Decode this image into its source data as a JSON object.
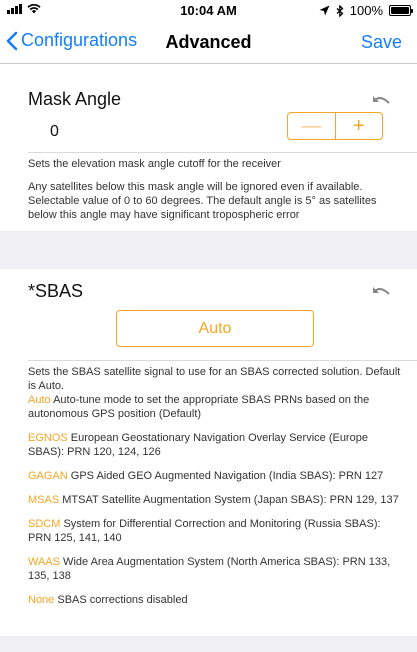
{
  "status_bar": {
    "time": "10:04 AM",
    "battery": "100%"
  },
  "nav": {
    "back_label": "Configurations",
    "title": "Advanced",
    "save_label": "Save"
  },
  "mask_angle": {
    "title": "Mask Angle",
    "value": "0",
    "minus_label": "—",
    "plus_label": "+",
    "summary": "Sets the elevation mask angle cutoff for the receiver",
    "details": "Any satellites below this mask angle will be ignored even if available. Selectable value of 0 to 60 degrees. The default angle is 5° as satellites below this angle may have significant tropospheric error"
  },
  "sbas": {
    "title": "*SBAS",
    "selected": "Auto",
    "summary": "Sets the SBAS satellite signal to use for an SBAS corrected solution. Default is Auto.",
    "options": [
      {
        "key": "Auto",
        "text": " Auto-tune mode to set the appropriate SBAS PRNs based on the autonomous GPS position (Default)"
      },
      {
        "key": "EGNOS",
        "text": " European Geostationary Navigation Overlay Service (Europe SBAS): PRN 120, 124, 126"
      },
      {
        "key": "GAGAN",
        "text": " GPS Aided GEO Augmented Navigation (India SBAS): PRN 127"
      },
      {
        "key": "MSAS",
        "text": " MTSAT Satellite Augmentation System (Japan SBAS): PRN 129, 137"
      },
      {
        "key": "SDCM",
        "text": " System for Differential Correction and Monitoring (Russia SBAS): PRN 125, 141, 140"
      },
      {
        "key": "WAAS",
        "text": " Wide Area Augmentation System (North America SBAS): PRN 133, 135, 138"
      },
      {
        "key": "None",
        "text": " SBAS corrections disabled"
      }
    ]
  },
  "colors": {
    "accent": "#f5a623",
    "link": "#147efb",
    "background_band": "#efeff4"
  },
  "icons": {
    "back": "chevron-left-icon",
    "undo": "undo-icon",
    "location": "location-arrow-icon",
    "bluetooth": "bluetooth-icon",
    "wifi": "wifi-icon",
    "signal": "signal-bars-icon",
    "battery": "battery-icon"
  }
}
